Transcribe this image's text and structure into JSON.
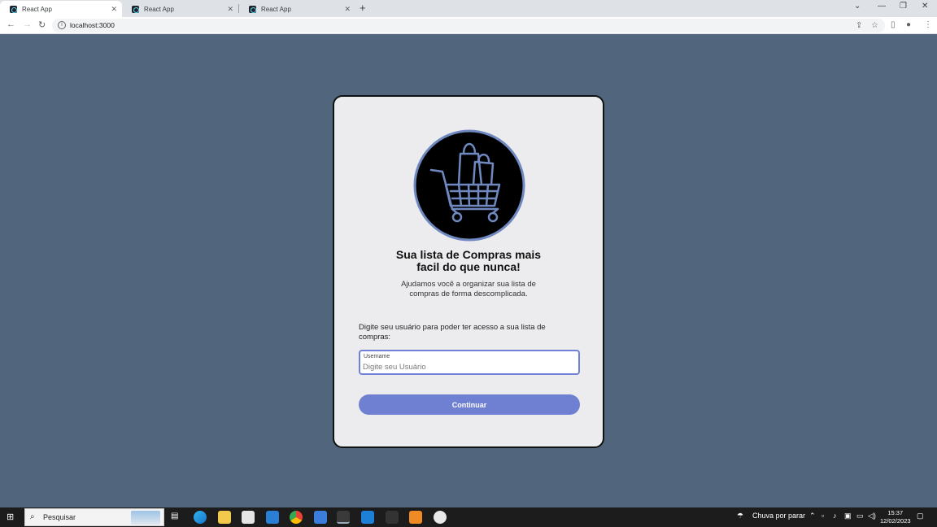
{
  "browser": {
    "tabs": [
      {
        "title": "React App",
        "active": true
      },
      {
        "title": "React App",
        "active": false
      },
      {
        "title": "React App",
        "active": false
      }
    ],
    "url": "localhost:3000"
  },
  "card": {
    "title_line1": "Sua lista de Compras mais",
    "title_line2": "facil do que nunca!",
    "subtitle_line1": "Ajudamos você a organizar sua lista de",
    "subtitle_line2": "compras de forma descomplicada.",
    "prompt": "Digite seu usuário para poder ter acesso a sua lista de compras:",
    "username_label": "Username",
    "username_placeholder": "Digite seu Usuário",
    "continue_label": "Continuar"
  },
  "taskbar": {
    "search_placeholder": "Pesquisar",
    "weather": "Chuva por parar",
    "time": "15:37",
    "date": "12/02/2023"
  },
  "colors": {
    "page_bg": "#51667c",
    "card_bg": "#ececee",
    "accent": "#6f7fd1",
    "logo_ring": "#6f89c0"
  }
}
